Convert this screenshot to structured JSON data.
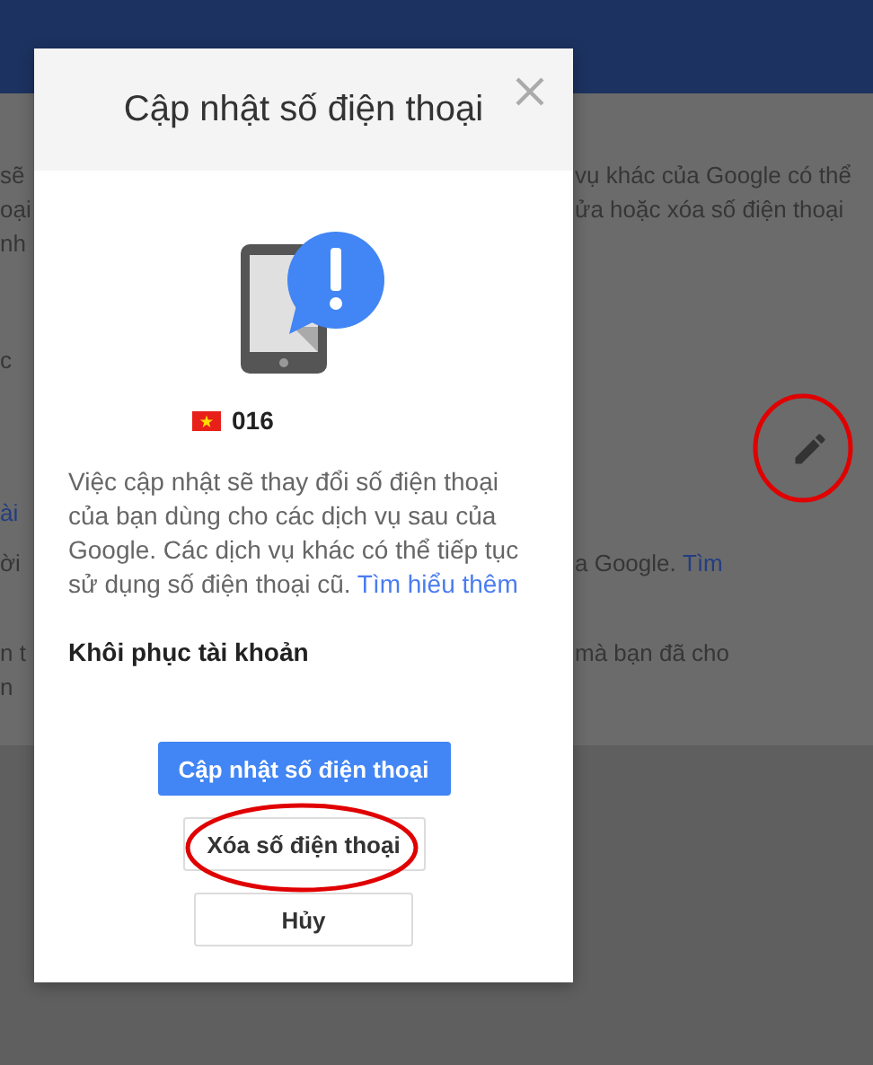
{
  "background_page": {
    "rows": [
      {
        "left": {
          "text": "sẽ",
          "kind": "text"
        },
        "right": {
          "text": "vụ khác của Google có thể",
          "kind": "text"
        }
      },
      {
        "left": {
          "text": "oại",
          "kind": "text"
        },
        "right": {
          "text": "ửa hoặc xóa số điện thoại",
          "kind": "text"
        }
      },
      {
        "left": {
          "text": "nh",
          "kind": "text"
        }
      },
      {
        "left": {
          "text": "c",
          "kind": "text"
        }
      },
      {
        "right": {
          "kind": "edit",
          "circled": true
        }
      },
      {
        "left": {
          "text": "ài",
          "kind": "link"
        }
      },
      {
        "left": {
          "text": "ời",
          "kind": "text"
        },
        "right": {
          "text": "a Google.",
          "link": "Tìm",
          "kind": "text"
        }
      },
      {
        "left": {
          "text": "n t",
          "kind": "text"
        },
        "right": {
          "text": "mà bạn đã cho",
          "kind": "text"
        }
      },
      {
        "left": {
          "text": "n",
          "kind": "text"
        }
      }
    ]
  },
  "dialog": {
    "title": "Cập nhật số điện thoại",
    "phone_number": "016",
    "message": "Việc cập nhật sẽ thay đổi số điện thoại của bạn dùng cho các dịch vụ sau của Google. Các dịch vụ khác có thể tiếp tục sử dụng số điện thoại cũ.",
    "link": "Tìm hiểu thêm",
    "section_heading": "Khôi phục tài khoản",
    "buttons": [
      {
        "label": "Cập nhật số điện thoại",
        "kind": "primary",
        "circled": false
      },
      {
        "label": "Xóa số điện thoại",
        "kind": "secondary",
        "circled": true
      },
      {
        "label": "Hủy",
        "kind": "secondary",
        "circled": false
      }
    ]
  }
}
